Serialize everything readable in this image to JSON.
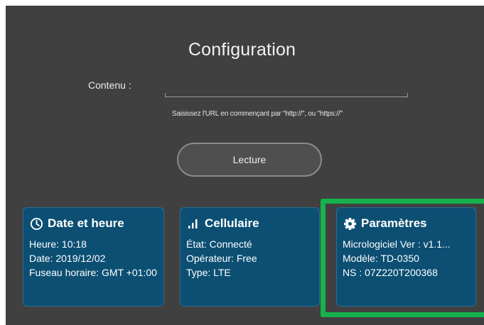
{
  "page": {
    "title": "Configuration"
  },
  "form": {
    "content_label": "Contenu :",
    "url_value": "",
    "hint": "Saisissez l'URL en commençant par \"http://\", ou \"https://\"",
    "read_button": "Lecture"
  },
  "cards": {
    "datetime": {
      "icon": "clock-icon",
      "title": "Date et heure",
      "time": "Heure: 10:18",
      "date": "Date: 2019/12/02",
      "timezone": "Fuseau horaire: GMT +01:00"
    },
    "cellular": {
      "icon": "signal-bars-icon",
      "title": "Cellulaire",
      "status": "État: Connecté",
      "operator": "Opérateur: Free",
      "type": "Type: LTE"
    },
    "settings": {
      "icon": "gear-icon",
      "title": "Paramètres",
      "firmware": "Micrologiciel Ver : v1.1...",
      "model": "Modèle: TD-0350",
      "serial": "NS : 07Z220T200368"
    }
  },
  "colors": {
    "background": "#404040",
    "card": "#0c4f73",
    "highlight": "#17b14d"
  }
}
